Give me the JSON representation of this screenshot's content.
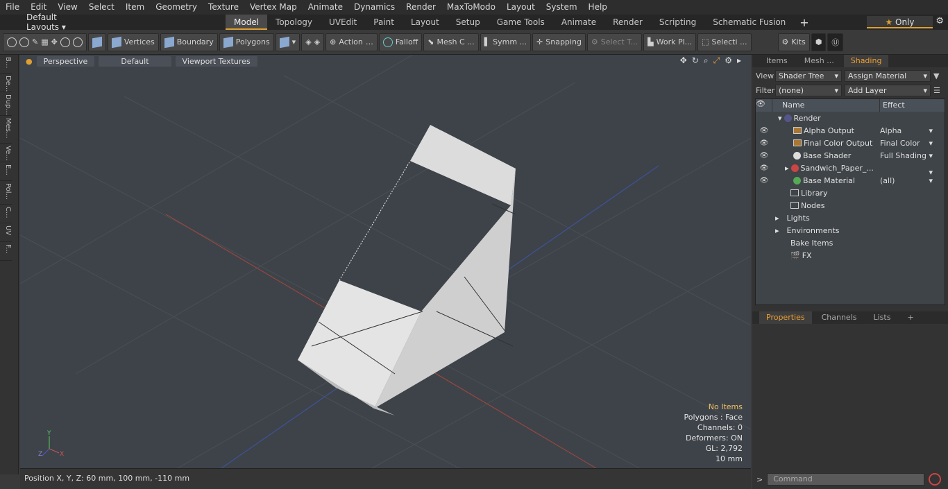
{
  "menu": [
    "File",
    "Edit",
    "View",
    "Select",
    "Item",
    "Geometry",
    "Texture",
    "Vertex Map",
    "Animate",
    "Dynamics",
    "Render",
    "MaxToModo",
    "Layout",
    "System",
    "Help"
  ],
  "layouts_label": "Default Layouts",
  "tabs": [
    "Model",
    "Topology",
    "UVEdit",
    "Paint",
    "Layout",
    "Setup",
    "Game Tools",
    "Animate",
    "Render",
    "Scripting",
    "Schematic Fusion"
  ],
  "only_label": "Only",
  "toolbar": {
    "vertices": "Vertices",
    "boundary": "Boundary",
    "polygons": "Polygons",
    "action": "Action",
    "falloff": "Falloff",
    "mesh": "Mesh C ...",
    "symm": "Symm ...",
    "snapping": "Snapping",
    "select_t": "Select T...",
    "work_pl": "Work Pl...",
    "selecti": "Selecti ...",
    "kits": "Kits"
  },
  "sidebar": [
    "B...",
    "De...",
    "Dup...",
    "Mes...",
    "Ve...",
    "E...",
    "Pol...",
    "C...",
    "UV",
    "F..."
  ],
  "viewport": {
    "perspective": "Perspective",
    "default": "Default",
    "textures": "Viewport Textures",
    "info": {
      "noitems": "No Items",
      "polygons": "Polygons : Face",
      "channels": "Channels: 0",
      "deformers": "Deformers: ON",
      "gl": "GL: 2,792",
      "size": "10 mm"
    }
  },
  "status": "Position X, Y, Z:  60 mm, 100 mm, -110 mm",
  "right": {
    "tabs": [
      "Items",
      "Mesh ...",
      "Shading"
    ],
    "view_label": "View",
    "view_value": "Shader Tree",
    "assign": "Assign Material",
    "filter_label": "Filter",
    "filter_value": "(none)",
    "add_layer": "Add Layer",
    "col_name": "Name",
    "col_effect": "Effect",
    "rows": [
      {
        "name": "Render",
        "effect": ""
      },
      {
        "name": "Alpha Output",
        "effect": "Alpha"
      },
      {
        "name": "Final Color Output",
        "effect": "Final Color"
      },
      {
        "name": "Base Shader",
        "effect": "Full Shading"
      },
      {
        "name": "Sandwich_Paper_...",
        "effect": ""
      },
      {
        "name": "Base Material",
        "effect": "(all)"
      },
      {
        "name": "Library",
        "effect": ""
      },
      {
        "name": "Nodes",
        "effect": ""
      },
      {
        "name": "Lights",
        "effect": ""
      },
      {
        "name": "Environments",
        "effect": ""
      },
      {
        "name": "Bake Items",
        "effect": ""
      },
      {
        "name": "FX",
        "effect": ""
      }
    ],
    "ptabs": [
      "Properties",
      "Channels",
      "Lists"
    ],
    "command": "Command"
  }
}
